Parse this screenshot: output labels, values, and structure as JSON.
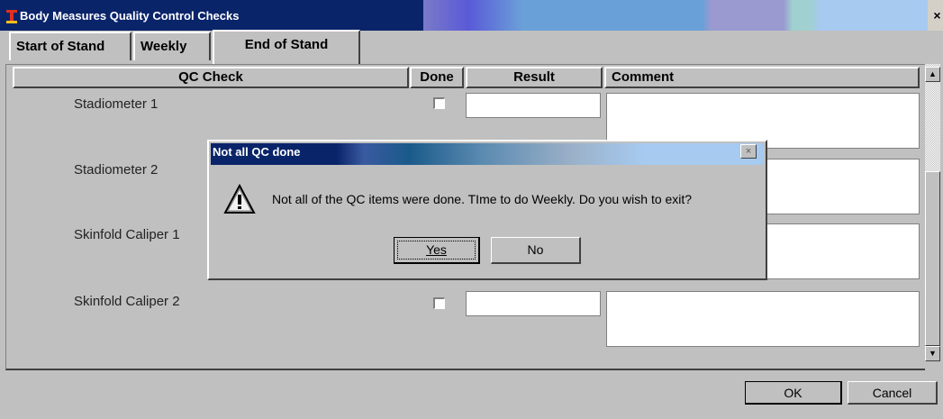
{
  "window": {
    "title": "Body Measures Quality Control Checks",
    "close_glyph": "×"
  },
  "tabs": [
    {
      "label": "Start of Stand"
    },
    {
      "label": "Weekly"
    },
    {
      "label": "End of Stand",
      "active": true
    }
  ],
  "grid": {
    "columns": [
      "QC Check",
      "Done",
      "Result",
      "Comment"
    ],
    "rows": [
      {
        "check": "Stadiometer 1",
        "done": false,
        "result": "",
        "comment": ""
      },
      {
        "check": "Stadiometer 2",
        "done": false,
        "result": "",
        "comment": ""
      },
      {
        "check": "Skinfold Caliper 1",
        "done": false,
        "result": "",
        "comment": ""
      },
      {
        "check": "Skinfold Caliper 2",
        "done": false,
        "result": "",
        "comment": ""
      }
    ]
  },
  "scrollbar": {
    "up_glyph": "▲",
    "down_glyph": "▼"
  },
  "footer": {
    "ok_label": "OK",
    "cancel_label": "Cancel"
  },
  "dialog": {
    "title": "Not all QC done",
    "close_glyph": "×",
    "icon": "warning-icon",
    "message": "Not all of the QC items were done.  TIme to do Weekly.  Do you wish to exit?",
    "yes_label": "Yes",
    "no_label": "No"
  },
  "colors": {
    "titlebar": "#0a246a",
    "face": "#c0c0c0"
  }
}
